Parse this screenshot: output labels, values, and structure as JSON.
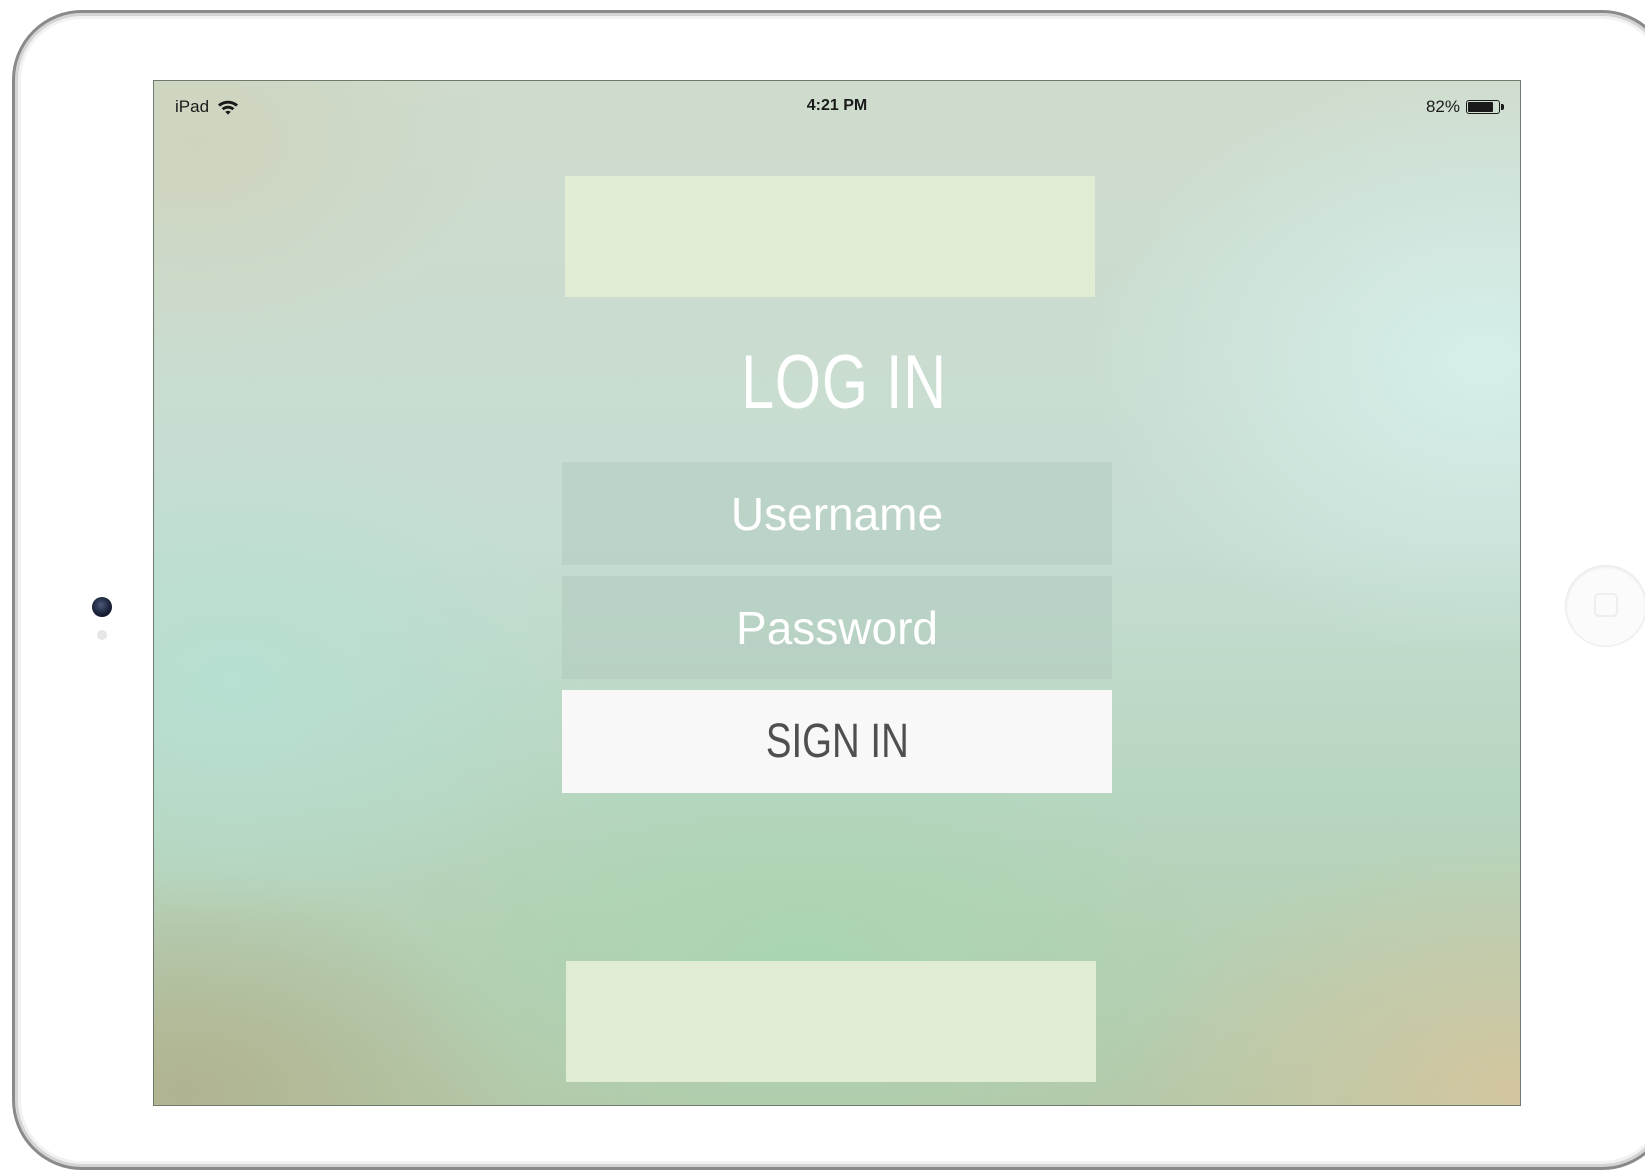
{
  "status_bar": {
    "device": "iPad",
    "time": "4:21 PM",
    "battery_percent": "82%",
    "battery_level": 0.82
  },
  "login": {
    "title": "LOG IN",
    "username_placeholder": "Username",
    "password_placeholder": "Password",
    "sign_in_label": "SIGN IN"
  },
  "colors": {
    "banner": "#e0ecd4",
    "button_background": "#f8f8f8",
    "button_text": "#4f4f4f",
    "title_text": "#ffffff"
  },
  "icons": {
    "status_left": "wifi-icon",
    "status_right": "battery-icon"
  }
}
